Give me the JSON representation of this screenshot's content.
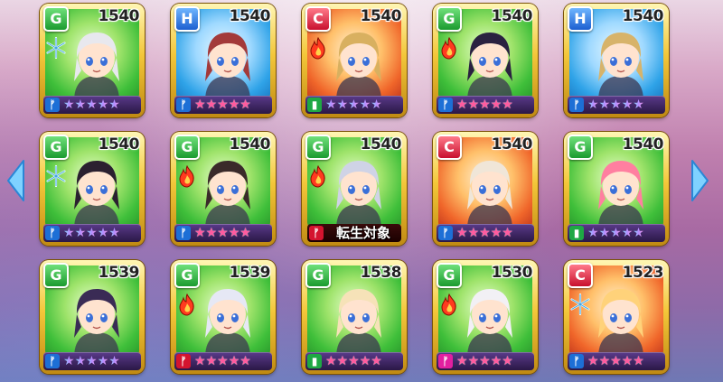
{
  "navigation": {
    "left_arrow_icon": "chevron-left-icon",
    "right_arrow_icon": "chevron-right-icon"
  },
  "colors": {
    "card_frame": "#f3c73a",
    "type_G": "#1b9b2f",
    "type_H": "#1c5fd0",
    "type_C": "#c8102e",
    "star_pink": "#ff5b9f"
  },
  "cards": [
    {
      "type": "G",
      "power": "1540",
      "bg": "green",
      "element": "snowflake-icon",
      "weapon": "racket-icon",
      "weapon_color": "blue",
      "stars": 5,
      "star_style": "rainbow",
      "tensei": ""
    },
    {
      "type": "H",
      "power": "1540",
      "bg": "blue",
      "element": "",
      "weapon": "racket-icon",
      "weapon_color": "blue",
      "stars": 5,
      "star_style": "pink",
      "tensei": ""
    },
    {
      "type": "C",
      "power": "1540",
      "bg": "red",
      "element": "flame-icon",
      "weapon": "bottle-icon",
      "weapon_color": "green",
      "stars": 5,
      "star_style": "rainbow",
      "tensei": ""
    },
    {
      "type": "G",
      "power": "1540",
      "bg": "green",
      "element": "flame-icon",
      "weapon": "racket-icon",
      "weapon_color": "blue",
      "stars": 5,
      "star_style": "pink",
      "tensei": ""
    },
    {
      "type": "H",
      "power": "1540",
      "bg": "blue",
      "element": "",
      "weapon": "racket-icon",
      "weapon_color": "blue",
      "stars": 5,
      "star_style": "rainbow",
      "tensei": ""
    },
    {
      "type": "G",
      "power": "1540",
      "bg": "green",
      "element": "snowflake-icon",
      "weapon": "racket-icon",
      "weapon_color": "blue",
      "stars": 5,
      "star_style": "rainbow",
      "tensei": ""
    },
    {
      "type": "G",
      "power": "1540",
      "bg": "green",
      "element": "flame-icon",
      "weapon": "racket-icon",
      "weapon_color": "blue",
      "stars": 5,
      "star_style": "pink",
      "tensei": ""
    },
    {
      "type": "G",
      "power": "1540",
      "bg": "green",
      "element": "flame-icon",
      "weapon": "racket-icon",
      "weapon_color": "red",
      "stars": 0,
      "star_style": "pink",
      "tensei": "転生対象"
    },
    {
      "type": "C",
      "power": "1540",
      "bg": "red",
      "element": "",
      "weapon": "racket-icon",
      "weapon_color": "blue",
      "stars": 5,
      "star_style": "pink",
      "tensei": ""
    },
    {
      "type": "G",
      "power": "1540",
      "bg": "green",
      "element": "",
      "weapon": "bottle-icon",
      "weapon_color": "green",
      "stars": 5,
      "star_style": "rainbow",
      "tensei": ""
    },
    {
      "type": "G",
      "power": "1539",
      "bg": "green",
      "element": "",
      "weapon": "racket-icon",
      "weapon_color": "blue",
      "stars": 5,
      "star_style": "rainbow",
      "tensei": ""
    },
    {
      "type": "G",
      "power": "1539",
      "bg": "green",
      "element": "flame-icon",
      "weapon": "racket-icon",
      "weapon_color": "red",
      "stars": 5,
      "star_style": "pink",
      "tensei": ""
    },
    {
      "type": "G",
      "power": "1538",
      "bg": "green",
      "element": "",
      "weapon": "bottle-icon",
      "weapon_color": "green",
      "stars": 5,
      "star_style": "pink",
      "tensei": ""
    },
    {
      "type": "G",
      "power": "1530",
      "bg": "green",
      "element": "flame-icon",
      "weapon": "racket-icon",
      "weapon_color": "pink",
      "stars": 5,
      "star_style": "pink",
      "tensei": ""
    },
    {
      "type": "C",
      "power": "1523",
      "bg": "red",
      "element": "snowflake-icon",
      "weapon": "racket-icon",
      "weapon_color": "blue",
      "stars": 5,
      "star_style": "pink",
      "tensei": ""
    }
  ]
}
